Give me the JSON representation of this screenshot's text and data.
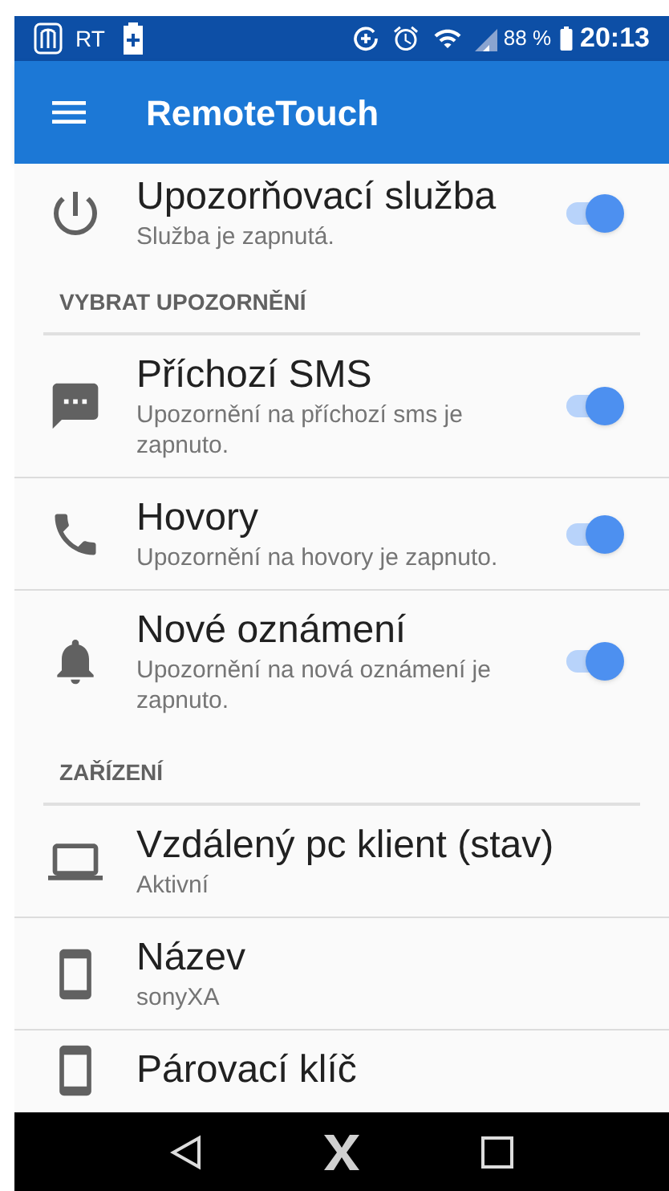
{
  "status_bar": {
    "carrier": "RT",
    "battery": "88 %",
    "time": "20:13"
  },
  "app_bar": {
    "title": "RemoteTouch"
  },
  "service": {
    "title": "Upozorňovací služba",
    "subtitle": "Služba je zapnutá.",
    "on": true
  },
  "sections": [
    {
      "header": "VYBRAT UPOZORNĚNÍ",
      "items": [
        {
          "kind": "toggle",
          "title": "Příchozí SMS",
          "subtitle": "Upozornění na příchozí sms je zapnuto.",
          "on": true
        },
        {
          "kind": "toggle",
          "title": "Hovory",
          "subtitle": "Upozornění na hovory je zapnuto.",
          "on": true
        },
        {
          "kind": "toggle",
          "title": "Nové oznámení",
          "subtitle": "Upozornění na nová oznámení je zapnuto.",
          "on": true
        }
      ]
    },
    {
      "header": "ZAŘÍZENÍ",
      "items": [
        {
          "kind": "info",
          "title": "Vzdálený pc klient (stav)",
          "subtitle": "Aktivní"
        },
        {
          "kind": "info",
          "title": "Název",
          "subtitle": "sonyXA"
        },
        {
          "kind": "info",
          "title": "Párovací klíč"
        }
      ]
    }
  ]
}
